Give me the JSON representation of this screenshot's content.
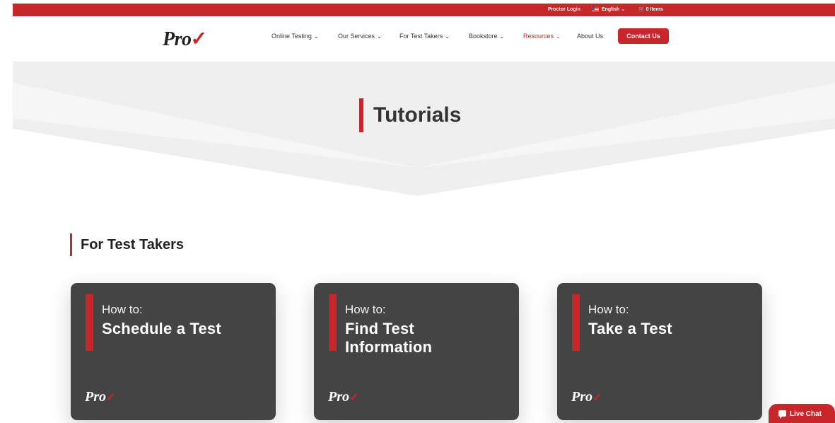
{
  "topbar": {
    "proctor_login": "Proctor Login",
    "language": "English",
    "language_chevron": "⌄",
    "cart_icon": "🛒",
    "cart_text": "0 Items"
  },
  "header": {
    "logo_text": "Pro",
    "logo_check": "✓",
    "nav": [
      {
        "label": "Online Testing",
        "chevron": "⌄"
      },
      {
        "label": "Our Services",
        "chevron": "⌄"
      },
      {
        "label": "For Test Takers",
        "chevron": "⌄"
      },
      {
        "label": "Bookstore",
        "chevron": "⌄"
      },
      {
        "label": "Resources",
        "chevron": "⌄"
      },
      {
        "label": "About Us"
      }
    ],
    "contact_label": "Contact Us"
  },
  "hero": {
    "title": "Tutorials"
  },
  "section": {
    "title": "For Test Takers"
  },
  "cards": [
    {
      "prefix": "How to:",
      "title": "Schedule a Test",
      "logo_text": "Pro",
      "logo_check": "✓"
    },
    {
      "prefix": "How to:",
      "title": "Find Test Information",
      "logo_text": "Pro",
      "logo_check": "✓"
    },
    {
      "prefix": "How to:",
      "title": "Take a Test",
      "logo_text": "Pro",
      "logo_check": "✓"
    }
  ],
  "livechat": {
    "label": "Live Chat"
  },
  "colors": {
    "accent": "#c9262c",
    "card_bg": "#444444",
    "hero_bg": "#eeeeee",
    "text_dark": "#333333"
  }
}
